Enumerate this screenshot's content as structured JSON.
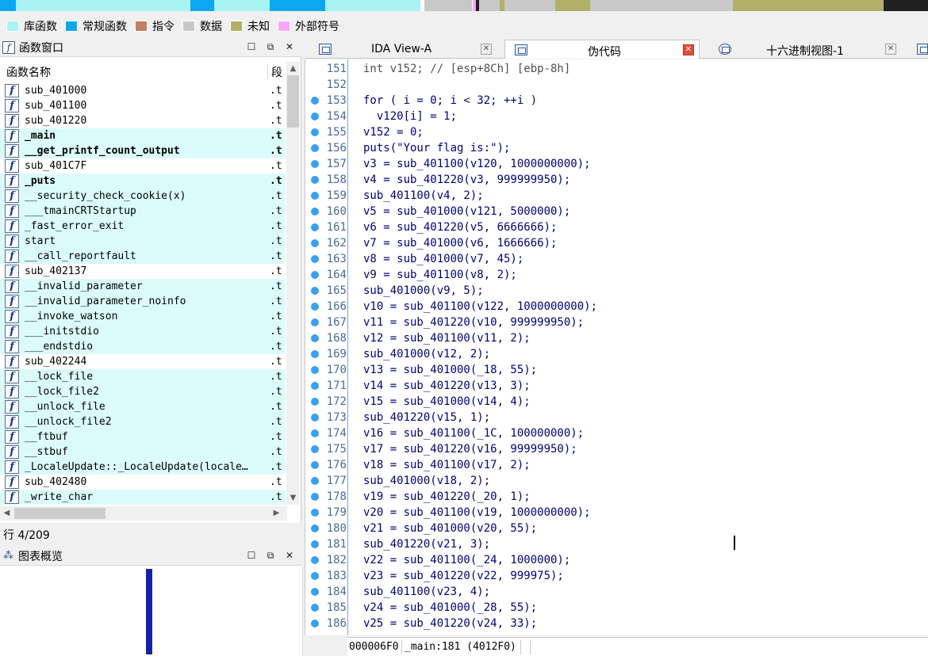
{
  "legend": [
    {
      "label": "库函数",
      "color": "#a8f4f4"
    },
    {
      "label": "常规函数",
      "color": "#0aa8f0"
    },
    {
      "label": "指令",
      "color": "#c08060"
    },
    {
      "label": "数据",
      "color": "#c8c8c8"
    },
    {
      "label": "未知",
      "color": "#b0b068"
    },
    {
      "label": "外部符号",
      "color": "#f8a8f8"
    }
  ],
  "functions_window": {
    "title": "函数窗口",
    "col_name": "函数名称",
    "col_segment": "段",
    "rows": [
      {
        "name": "sub_401000",
        "seg": ".t",
        "lib": false,
        "bold": false
      },
      {
        "name": "sub_401100",
        "seg": ".t",
        "lib": false,
        "bold": false
      },
      {
        "name": "sub_401220",
        "seg": ".t",
        "lib": false,
        "bold": false
      },
      {
        "name": "_main",
        "seg": ".t",
        "lib": true,
        "bold": true
      },
      {
        "name": "__get_printf_count_output",
        "seg": ".t",
        "lib": true,
        "bold": true
      },
      {
        "name": "sub_401C7F",
        "seg": ".t",
        "lib": false,
        "bold": false
      },
      {
        "name": "_puts",
        "seg": ".t",
        "lib": true,
        "bold": true
      },
      {
        "name": "__security_check_cookie(x)",
        "seg": ".t",
        "lib": true,
        "bold": false
      },
      {
        "name": "___tmainCRTStartup",
        "seg": ".t",
        "lib": true,
        "bold": false
      },
      {
        "name": "_fast_error_exit",
        "seg": ".t",
        "lib": true,
        "bold": false
      },
      {
        "name": "start",
        "seg": ".t",
        "lib": true,
        "bold": false
      },
      {
        "name": "__call_reportfault",
        "seg": ".t",
        "lib": true,
        "bold": false
      },
      {
        "name": "sub_402137",
        "seg": ".t",
        "lib": false,
        "bold": false
      },
      {
        "name": "__invalid_parameter",
        "seg": ".t",
        "lib": true,
        "bold": false
      },
      {
        "name": "__invalid_parameter_noinfo",
        "seg": ".t",
        "lib": true,
        "bold": false
      },
      {
        "name": "__invoke_watson",
        "seg": ".t",
        "lib": true,
        "bold": false
      },
      {
        "name": "___initstdio",
        "seg": ".t",
        "lib": true,
        "bold": false
      },
      {
        "name": "___endstdio",
        "seg": ".t",
        "lib": true,
        "bold": false
      },
      {
        "name": "sub_402244",
        "seg": ".t",
        "lib": false,
        "bold": false
      },
      {
        "name": "__lock_file",
        "seg": ".t",
        "lib": true,
        "bold": false
      },
      {
        "name": "__lock_file2",
        "seg": ".t",
        "lib": true,
        "bold": false
      },
      {
        "name": "__unlock_file",
        "seg": ".t",
        "lib": true,
        "bold": false
      },
      {
        "name": "__unlock_file2",
        "seg": ".t",
        "lib": true,
        "bold": false
      },
      {
        "name": "__ftbuf",
        "seg": ".t",
        "lib": true,
        "bold": false
      },
      {
        "name": "__stbuf",
        "seg": ".t",
        "lib": true,
        "bold": false
      },
      {
        "name": "_LocaleUpdate::_LocaleUpdate(locale…",
        "seg": ".t",
        "lib": true,
        "bold": false
      },
      {
        "name": "sub_402480",
        "seg": ".t",
        "lib": false,
        "bold": false
      },
      {
        "name": "_write_char",
        "seg": ".t",
        "lib": true,
        "bold": false
      }
    ]
  },
  "row_status": "行 4/209",
  "graph_overview": {
    "title": "图表概览"
  },
  "tabs": [
    {
      "label": "IDA View-A",
      "active": false
    },
    {
      "label": "伪代码",
      "active": true
    },
    {
      "label": "十六进制视图-1",
      "active": false
    }
  ],
  "code_lines": [
    {
      "num": "151",
      "bp": false,
      "text": "int v152; // [esp+8Ch] [ebp-8h]"
    },
    {
      "num": "152",
      "bp": false,
      "text": ""
    },
    {
      "num": "153",
      "bp": true,
      "text": "for ( i = 0; i < 32; ++i )"
    },
    {
      "num": "154",
      "bp": true,
      "text": "  v120[i] = 1;"
    },
    {
      "num": "155",
      "bp": true,
      "text": "v152 = 0;"
    },
    {
      "num": "156",
      "bp": true,
      "text": "puts(\"Your flag is:\");"
    },
    {
      "num": "157",
      "bp": true,
      "text": "v3 = sub_401100(v120, 1000000000);"
    },
    {
      "num": "158",
      "bp": true,
      "text": "v4 = sub_401220(v3, 999999950);"
    },
    {
      "num": "159",
      "bp": true,
      "text": "sub_401100(v4, 2);"
    },
    {
      "num": "160",
      "bp": true,
      "text": "v5 = sub_401000(v121, 5000000);"
    },
    {
      "num": "161",
      "bp": true,
      "text": "v6 = sub_401220(v5, 6666666);"
    },
    {
      "num": "162",
      "bp": true,
      "text": "v7 = sub_401000(v6, 1666666);"
    },
    {
      "num": "163",
      "bp": true,
      "text": "v8 = sub_401000(v7, 45);"
    },
    {
      "num": "164",
      "bp": true,
      "text": "v9 = sub_401100(v8, 2);"
    },
    {
      "num": "165",
      "bp": true,
      "text": "sub_401000(v9, 5);"
    },
    {
      "num": "166",
      "bp": true,
      "text": "v10 = sub_401100(v122, 1000000000);"
    },
    {
      "num": "167",
      "bp": true,
      "text": "v11 = sub_401220(v10, 999999950);"
    },
    {
      "num": "168",
      "bp": true,
      "text": "v12 = sub_401100(v11, 2);"
    },
    {
      "num": "169",
      "bp": true,
      "text": "sub_401000(v12, 2);"
    },
    {
      "num": "170",
      "bp": true,
      "text": "v13 = sub_401000(_18, 55);"
    },
    {
      "num": "171",
      "bp": true,
      "text": "v14 = sub_401220(v13, 3);"
    },
    {
      "num": "172",
      "bp": true,
      "text": "v15 = sub_401000(v14, 4);"
    },
    {
      "num": "173",
      "bp": true,
      "text": "sub_401220(v15, 1);"
    },
    {
      "num": "174",
      "bp": true,
      "text": "v16 = sub_401100(_1C, 100000000);"
    },
    {
      "num": "175",
      "bp": true,
      "text": "v17 = sub_401220(v16, 99999950);"
    },
    {
      "num": "176",
      "bp": true,
      "text": "v18 = sub_401100(v17, 2);"
    },
    {
      "num": "177",
      "bp": true,
      "text": "sub_401000(v18, 2);"
    },
    {
      "num": "178",
      "bp": true,
      "text": "v19 = sub_401220(_20, 1);"
    },
    {
      "num": "179",
      "bp": true,
      "text": "v20 = sub_401100(v19, 1000000000);"
    },
    {
      "num": "180",
      "bp": true,
      "text": "v21 = sub_401000(v20, 55);"
    },
    {
      "num": "181",
      "bp": true,
      "text": "sub_401220(v21, 3);"
    },
    {
      "num": "182",
      "bp": true,
      "text": "v22 = sub_401100(_24, 1000000);"
    },
    {
      "num": "183",
      "bp": true,
      "text": "v23 = sub_401220(v22, 999975);"
    },
    {
      "num": "184",
      "bp": true,
      "text": "sub_401100(v23, 4);"
    },
    {
      "num": "185",
      "bp": true,
      "text": "v24 = sub_401000(_28, 55);"
    },
    {
      "num": "186",
      "bp": true,
      "text": "v25 = sub_401220(v24, 33);"
    }
  ],
  "statusbar": {
    "offset": "000006F0",
    "location": "_main:181 (4012F0)"
  }
}
